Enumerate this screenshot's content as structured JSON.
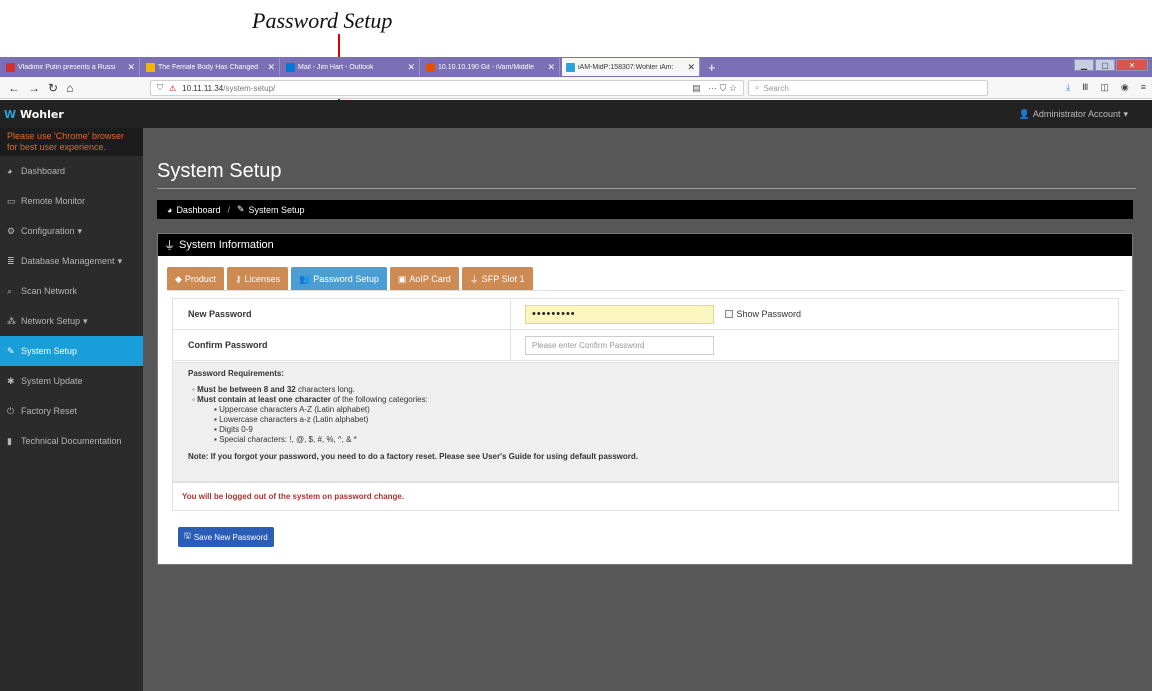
{
  "annotation": {
    "label": "Password Setup"
  },
  "browser": {
    "tabs": [
      {
        "title": "Vladimir Putin presents a Russi",
        "close": "✕",
        "icon_color": "#d32f2f"
      },
      {
        "title": "The Female Body Has Changed",
        "close": "✕",
        "icon_color": "#f4b400"
      },
      {
        "title": "Mail - Jim Hart - Outlook",
        "close": "✕",
        "icon_color": "#0078d4"
      },
      {
        "title": "10.10.10.190 Git - iVam/Middle",
        "close": "✕",
        "icon_color": "#e65100"
      },
      {
        "title": "iAM-MidP:158307:Wohler iAm:",
        "close": "✕",
        "icon_color": "#2aa3d8"
      }
    ],
    "new_tab": "+",
    "window_controls": {
      "minimize": "▁",
      "maximize": "▢",
      "close": "✕"
    },
    "url_host": "10.11.11.34",
    "url_path": "/system-setup/",
    "search_placeholder": "Search",
    "nav": {
      "back": "←",
      "forward": "→",
      "reload": "↻",
      "home": "⌂"
    }
  },
  "app": {
    "logo": "Wohler",
    "account_label": "Administrator Account"
  },
  "sidebar": {
    "warning": "Please use 'Chrome' browser for best user experience.",
    "items": [
      {
        "label": "Dashboard",
        "icon": "dashboard-icon",
        "glyph": "◕"
      },
      {
        "label": "Remote Monitor",
        "icon": "monitor-icon",
        "glyph": "▭"
      },
      {
        "label": "Configuration",
        "icon": "cogs-icon",
        "glyph": "⚙",
        "caret": "▾"
      },
      {
        "label": "Database Management",
        "icon": "database-icon",
        "glyph": "≣",
        "caret": "▾"
      },
      {
        "label": "Scan Network",
        "icon": "search-icon",
        "glyph": "⌕"
      },
      {
        "label": "Network Setup",
        "icon": "network-icon",
        "glyph": "⁂",
        "caret": "▾"
      },
      {
        "label": "System Setup",
        "icon": "wrench-icon",
        "glyph": "✎",
        "active": true
      },
      {
        "label": "System Update",
        "icon": "gear-icon",
        "glyph": "✱"
      },
      {
        "label": "Factory Reset",
        "icon": "power-icon",
        "glyph": "⏻"
      },
      {
        "label": "Technical Documentation",
        "icon": "book-icon",
        "glyph": "▮"
      }
    ]
  },
  "main": {
    "title": "System Setup",
    "breadcrumb": {
      "home": "Dashboard",
      "sep": "/",
      "current": "System Setup"
    },
    "panel_title": "System Information",
    "tabs": [
      {
        "label": "Product",
        "icon": "tag-icon"
      },
      {
        "label": "Licenses",
        "icon": "key-icon"
      },
      {
        "label": "Password Setup",
        "icon": "users-icon",
        "active": true
      },
      {
        "label": "AoIP Card",
        "icon": "card-icon"
      },
      {
        "label": "SFP Slot 1",
        "icon": "plug-icon"
      }
    ],
    "form": {
      "new_password_label": "New Password",
      "new_password_value": "•••••••••",
      "show_password_label": "Show Password",
      "confirm_label": "Confirm Password",
      "confirm_placeholder": "Please enter Confirm Password"
    },
    "requirements": {
      "heading": "Password Requirements:",
      "length_bold": "Must be between 8 and 32",
      "length_rest": " characters long.",
      "contain_bold": "Must contain at least one character",
      "contain_rest": " of the following categories:",
      "categories": [
        "Uppercase characters A-Z (Latin alphabet)",
        "Lowercase characters a-z (Latin alphabet)",
        "Digits 0-9",
        "Special characters: !, @, $, #, %, ^, & *"
      ],
      "note": "Note: If you forgot your password, you need to do a factory reset. Please see User's Guide for using default password."
    },
    "logout_notice": "You will be logged out of the system on password change.",
    "save_button": "Save New Password"
  }
}
